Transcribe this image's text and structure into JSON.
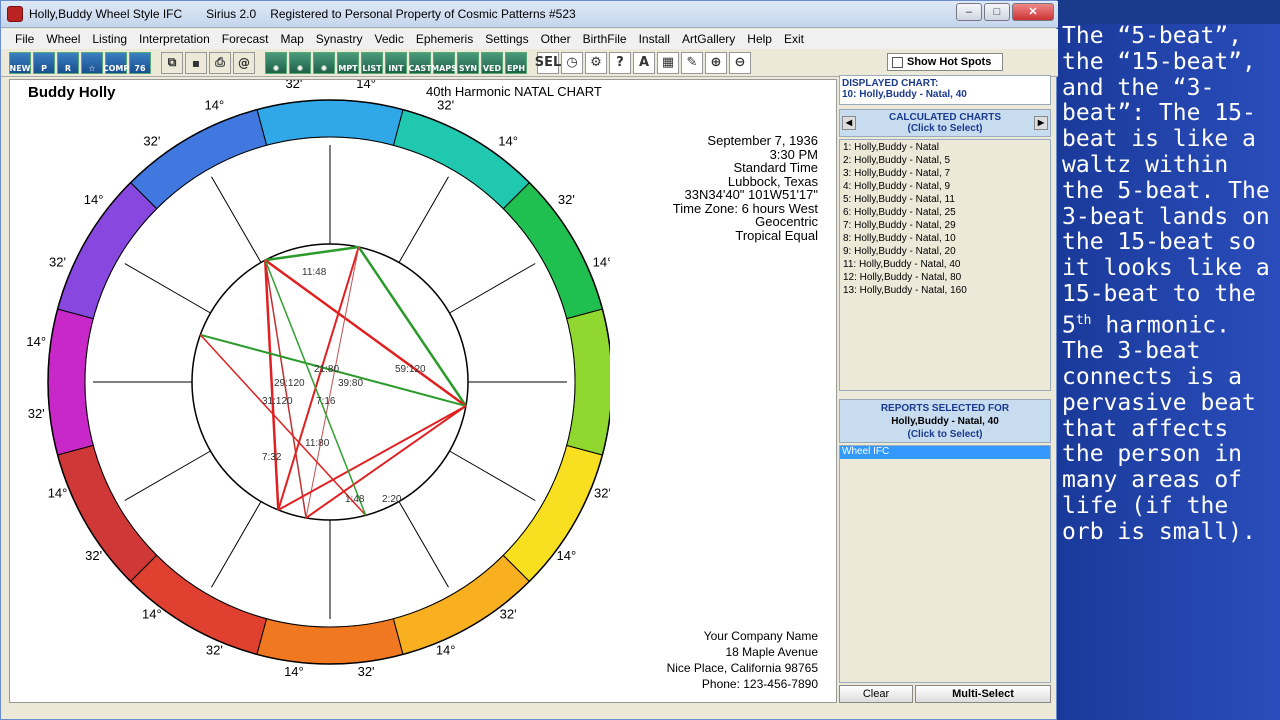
{
  "window": {
    "title": "Holly,Buddy Wheel Style IFC",
    "app": "Sirius 2.0",
    "registration": "Registered to Personal Property of Cosmic Patterns #523"
  },
  "menu": [
    "File",
    "Wheel",
    "Listing",
    "Interpretation",
    "Forecast",
    "Map",
    "Synastry",
    "Vedic",
    "Ephemeris",
    "Settings",
    "Other",
    "BirthFile",
    "Install",
    "ArtGallery",
    "Help",
    "Exit"
  ],
  "toolbar": {
    "buttons": [
      "NEW",
      "P",
      "R",
      "☆",
      "COMP",
      "76"
    ],
    "buttons2": [
      "MPT",
      "LIST",
      "INT",
      "CAST",
      "MAPS",
      "SYN",
      "VED",
      "EPH"
    ],
    "buttons3": [
      "SEL"
    ]
  },
  "chart": {
    "name": "Buddy Holly",
    "title": "40th Harmonic NATAL CHART",
    "details": [
      "September 7, 1936",
      "3:30 PM",
      "Standard Time",
      "Lubbock, Texas",
      "33N34'40\"  101W51'17\"",
      "Time Zone: 6 hours West",
      "Geocentric",
      "Tropical Equal"
    ],
    "address": [
      "Your Company Name",
      "18 Maple Avenue",
      "Nice Place, California 98765",
      "Phone: 123-456-7890"
    ],
    "sign_colors": [
      "#d03030",
      "#e04020",
      "#f07020",
      "#f8a020",
      "#f8d020",
      "#e8e820",
      "#80d020",
      "#20c040",
      "#20c0a0",
      "#30a0e0",
      "#4070e0",
      "#8040e0",
      "#c020c0"
    ],
    "cusp_degree": "14°",
    "cusp_minute": "32'",
    "center_labels": [
      "11:48",
      "21:80",
      "39:80",
      "29:120",
      "31:120",
      "7:16",
      "59:120",
      "7:32",
      "11:80",
      "1:48",
      "2:20"
    ]
  },
  "right": {
    "show_hot_spots": "Show Hot Spots",
    "displayed_label": "DISPLAYED CHART:",
    "displayed_value": "10: Holly,Buddy - Natal, 40",
    "calc_title": "CALCULATED CHARTS",
    "calc_sub": "(Click to Select)",
    "charts": [
      "1: Holly,Buddy - Natal",
      "2: Holly,Buddy - Natal, 5",
      "3: Holly,Buddy - Natal, 7",
      "4: Holly,Buddy - Natal, 9",
      "5: Holly,Buddy - Natal, 11",
      "6: Holly,Buddy - Natal, 25",
      "7: Holly,Buddy - Natal, 29",
      "8: Holly,Buddy - Natal, 10",
      "9: Holly,Buddy - Natal, 20",
      "11: Holly,Buddy - Natal, 40",
      "12: Holly,Buddy - Natal, 80",
      "13: Holly,Buddy - Natal, 160"
    ],
    "reports_title": "REPORTS SELECTED FOR",
    "reports_name": "Holly,Buddy - Natal, 40",
    "reports_sub": "(Click to Select)",
    "report_items": [
      "Wheel IFC"
    ],
    "clear": "Clear",
    "multi": "Multi-Select"
  },
  "commentary": "The “5-beat”, the “15-beat”, and the “3-beat”: The 15-beat is like a waltz within the 5-beat. The 3-beat lands on the 15-beat so it looks like a 15-beat to the 5",
  "commentary_sup": "th",
  "commentary_tail": " harmonic. The 3-beat connects is a pervasive beat that affects the person in many areas of life (if the orb is small)."
}
